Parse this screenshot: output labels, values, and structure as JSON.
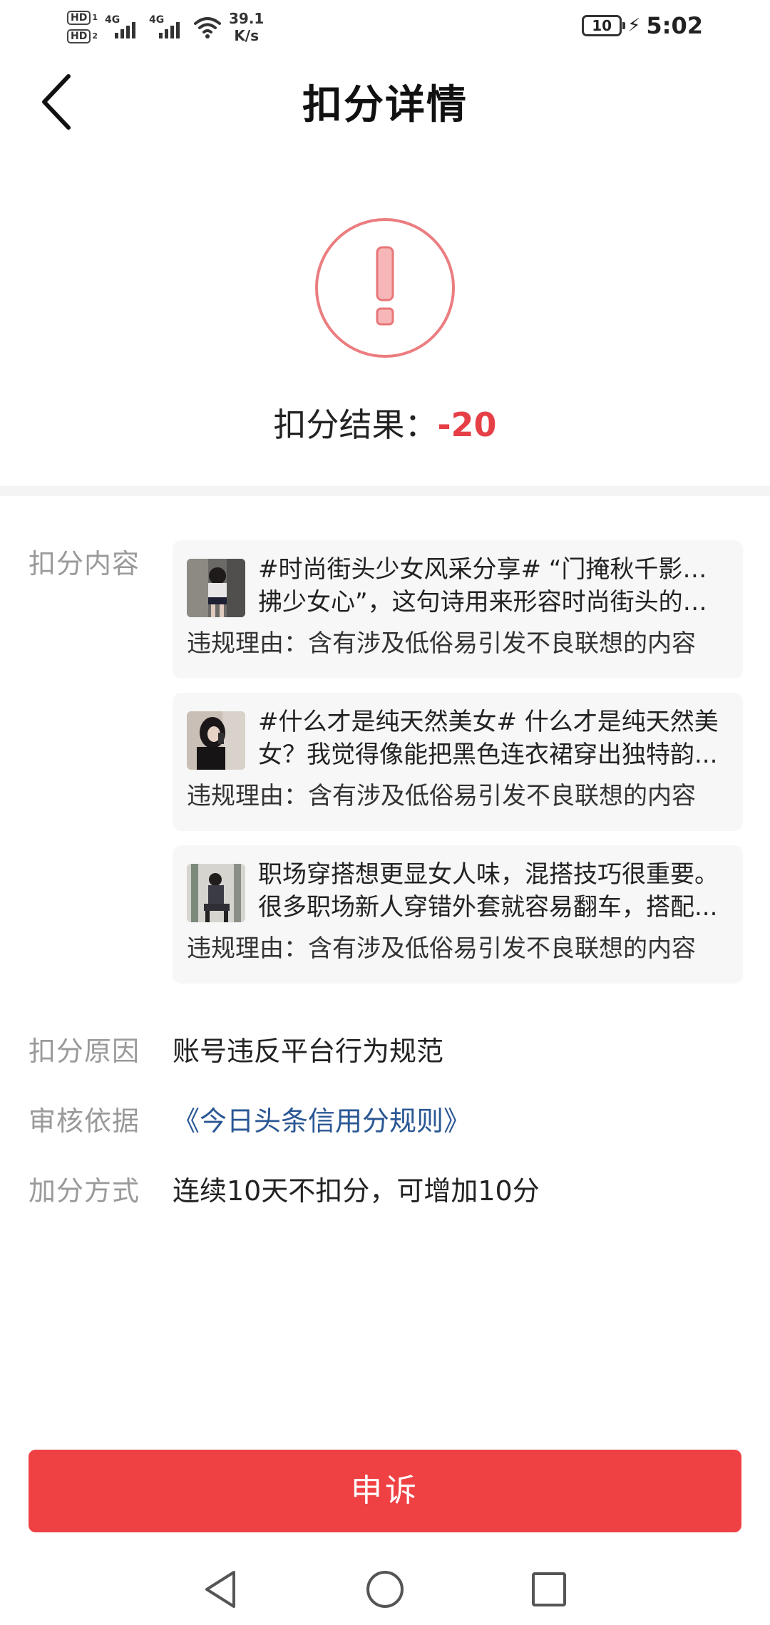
{
  "status_bar": {
    "sim1": "HD",
    "sim1_index": "1",
    "sim2": "HD",
    "sim2_index": "2",
    "net1": "4G",
    "net2": "4G",
    "speed_value": "39.1",
    "speed_unit": "K/s",
    "battery": "10",
    "time": "5:02"
  },
  "header": {
    "title": "扣分详情"
  },
  "result": {
    "label": "扣分结果：",
    "score": "-20",
    "icon": "exclamation-circle-icon",
    "accent_color": "#e64046"
  },
  "details": {
    "content_label": "扣分内容",
    "items": [
      {
        "line1": "#时尚街头少女风采分享# “门掩秋千影，风",
        "line2": "拂少女心”，这句诗用来形容时尚街头的少...",
        "reason": "违规理由：含有涉及低俗易引发不良联想的内容"
      },
      {
        "line1": "#什么才是纯天然美女# 什么才是纯天然美",
        "line2": "女？我觉得像能把黑色连衣裙穿出独特韵...",
        "reason": "违规理由：含有涉及低俗易引发不良联想的内容"
      },
      {
        "line1": "职场穿搭想更显女人味，混搭技巧很重要。",
        "line2": "很多职场新人穿错外套就容易翻车，搭配...",
        "reason": "违规理由：含有涉及低俗易引发不良联想的内容"
      }
    ],
    "reason_label": "扣分原因",
    "reason_value": "账号违反平台行为规范",
    "basis_label": "审核依据",
    "basis_value": "《今日头条信用分规则》",
    "bonus_label": "加分方式",
    "bonus_value": "连续10天不扣分，可增加10分"
  },
  "actions": {
    "appeal_label": "申诉",
    "appeal_color": "#ef4144"
  },
  "system_nav": {
    "back": "triangle-back-icon",
    "home": "circle-home-icon",
    "recents": "square-recents-icon"
  }
}
